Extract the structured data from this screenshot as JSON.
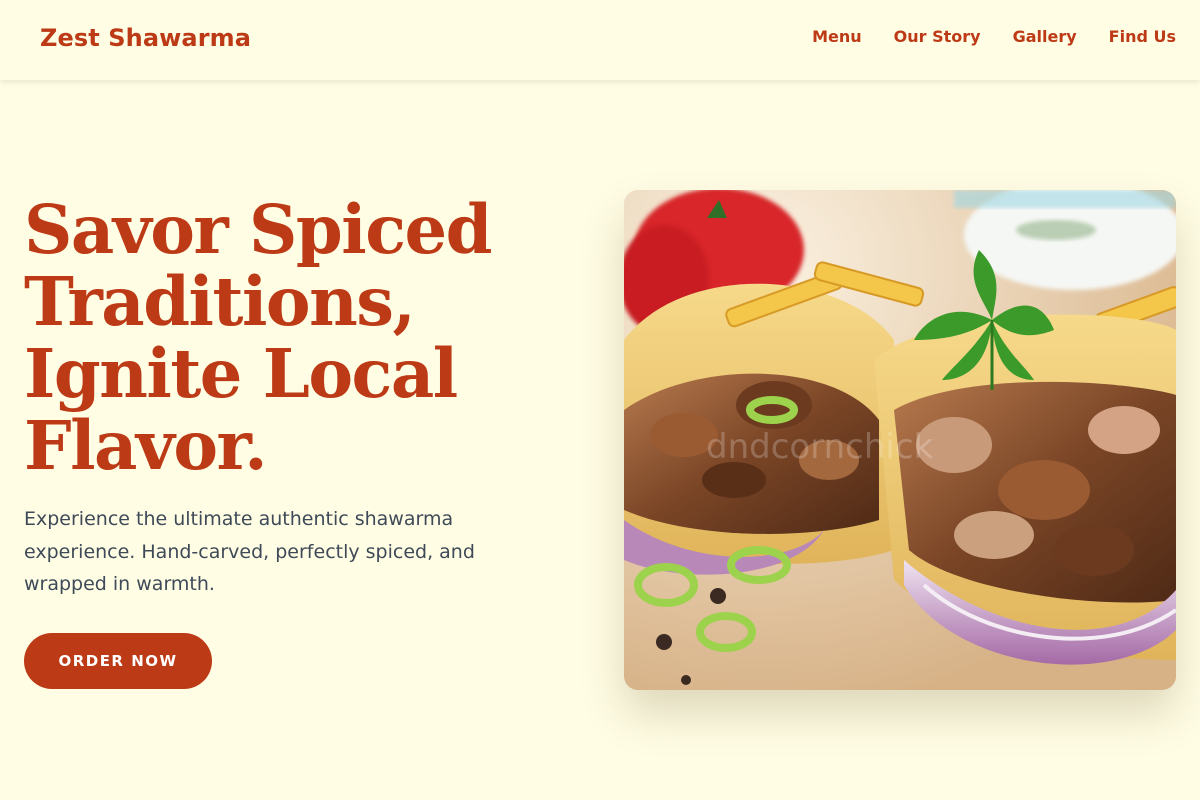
{
  "brand": {
    "name": "Zest Shawarma",
    "color": "#BD3A16"
  },
  "nav": {
    "items": [
      {
        "label": "Menu"
      },
      {
        "label": "Our Story"
      },
      {
        "label": "Gallery"
      },
      {
        "label": "Find Us"
      }
    ]
  },
  "hero": {
    "title": "Savor Spiced Traditions, Ignite Local Flavor.",
    "subtitle": "Experience the ultimate authentic shawarma experience. Hand-carved, perfectly spiced, and wrapped in warmth.",
    "cta_label": "ORDER NOW"
  },
  "image": {
    "subject": "shawarma wraps with fries, red onion, parsley, and green pepper rings",
    "watermark": "dndcornchick"
  },
  "colors": {
    "background": "#FFFDE4",
    "accent": "#BD3A16",
    "body_text": "#3F4A58"
  }
}
